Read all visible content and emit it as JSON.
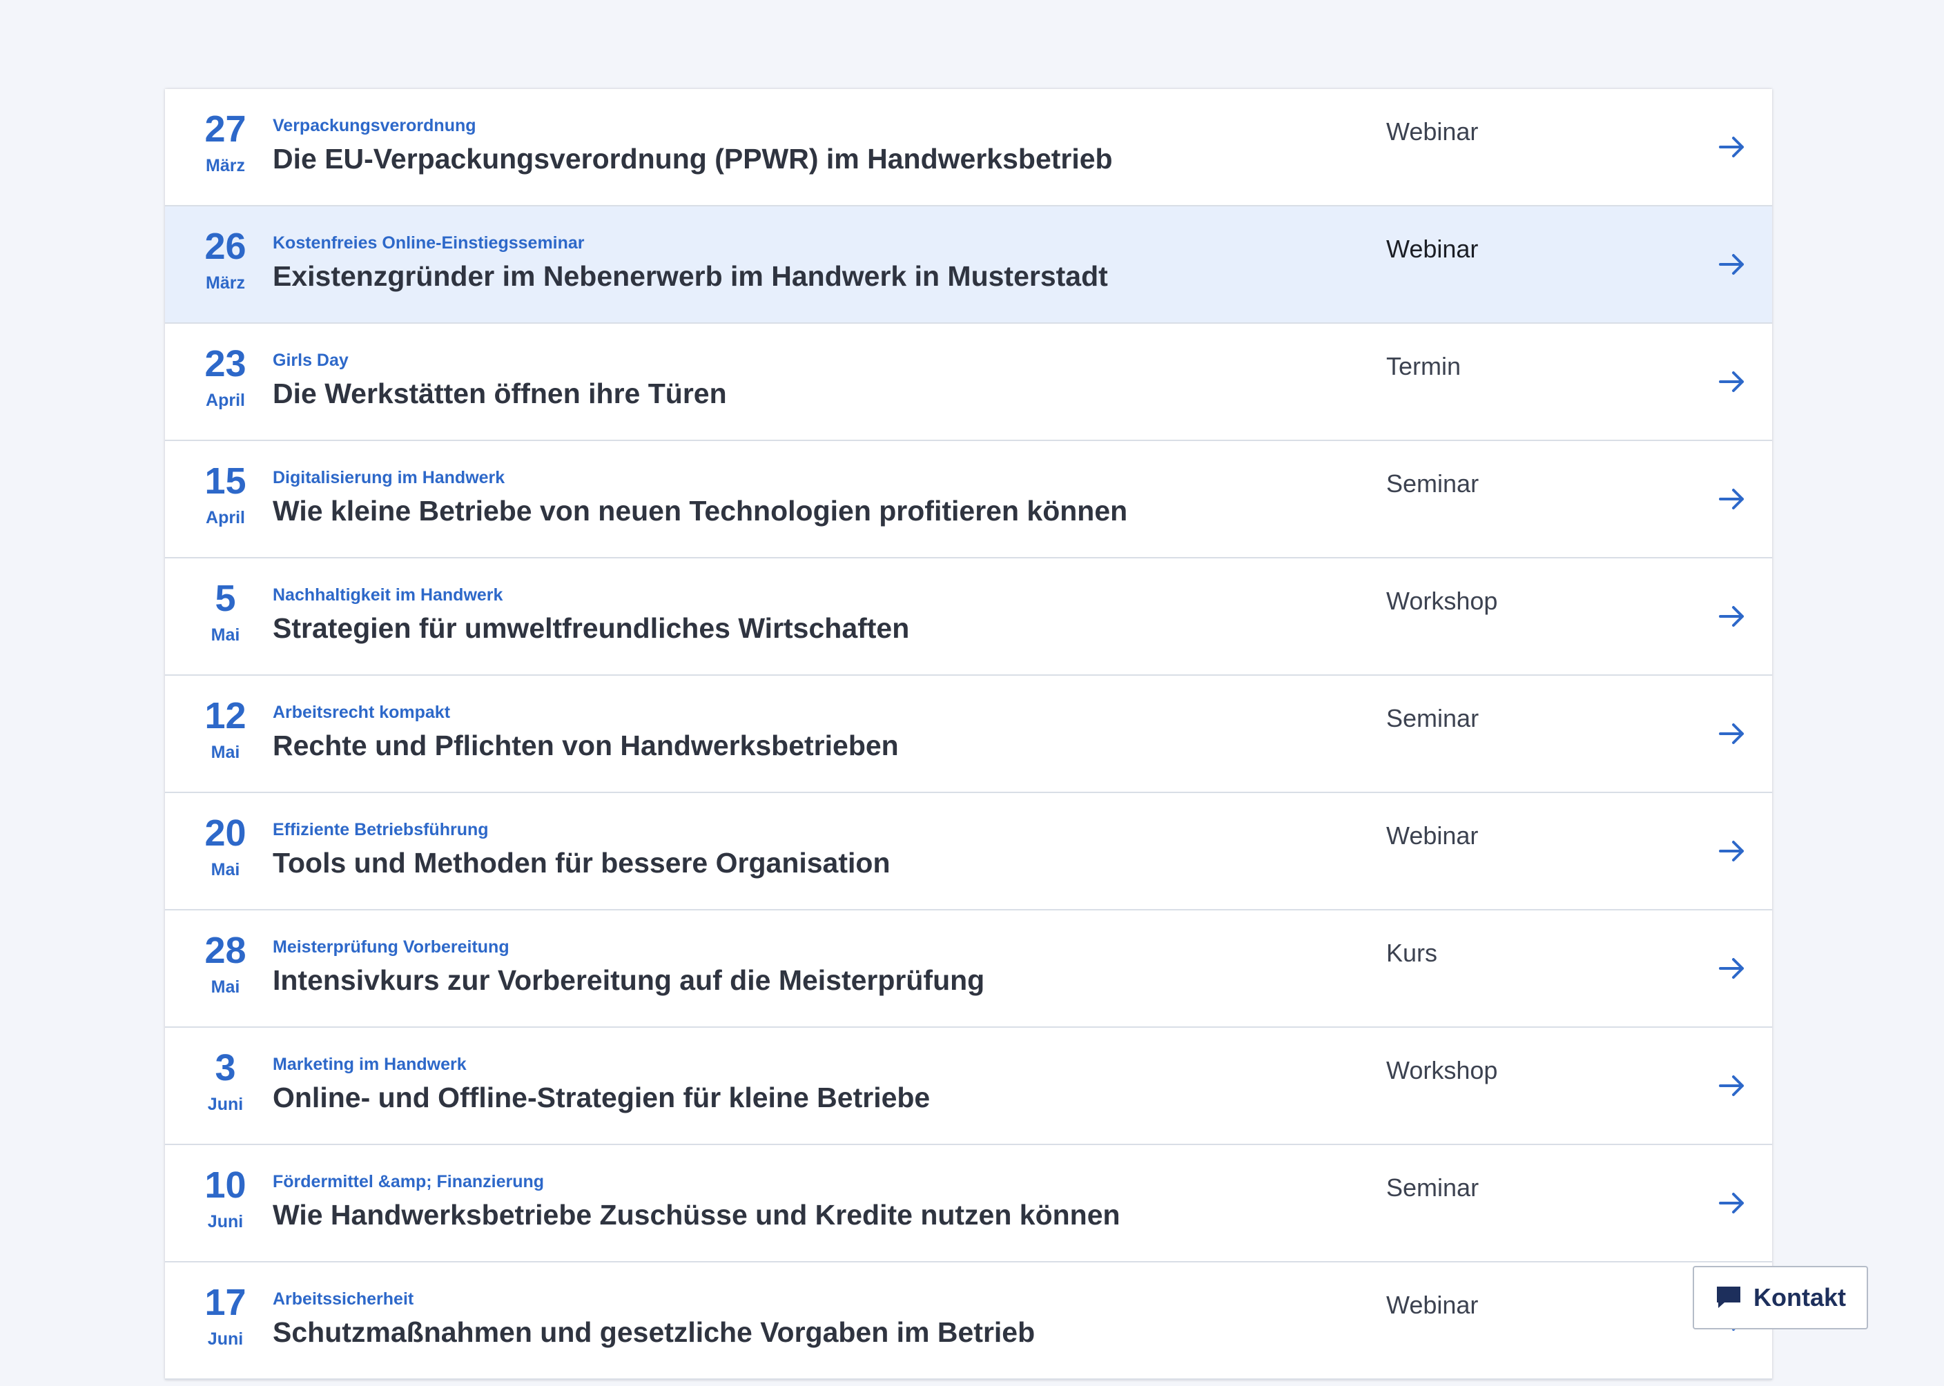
{
  "events": [
    {
      "day": "27",
      "month": "März",
      "category": "Verpackungsverordnung",
      "title": "Die EU-Verpackungsverordnung (PPWR) im Handwerksbetrieb",
      "type": "Webinar"
    },
    {
      "day": "26",
      "month": "März",
      "category": "Kostenfreies Online-Einstiegsseminar",
      "title": "Existenzgründer im Nebenerwerb im Handwerk in Musterstadt",
      "type": "Webinar"
    },
    {
      "day": "23",
      "month": "April",
      "category": "Girls Day",
      "title": "Die Werkstätten öffnen ihre Türen",
      "type": "Termin"
    },
    {
      "day": "15",
      "month": "April",
      "category": "Digitalisierung im Handwerk",
      "title": "Wie kleine Betriebe von neuen Technologien profitieren können",
      "type": "Seminar"
    },
    {
      "day": "5",
      "month": "Mai",
      "category": "Nachhaltigkeit im Handwerk",
      "title": "Strategien für umweltfreundliches Wirtschaften",
      "type": "Workshop"
    },
    {
      "day": "12",
      "month": "Mai",
      "category": "Arbeitsrecht kompakt",
      "title": "Rechte und Pflichten von Handwerksbetrieben",
      "type": "Seminar"
    },
    {
      "day": "20",
      "month": "Mai",
      "category": "Effiziente Betriebsführung",
      "title": "Tools und Methoden für bessere Organisation",
      "type": "Webinar"
    },
    {
      "day": "28",
      "month": "Mai",
      "category": "Meisterprüfung Vorbereitung",
      "title": "Intensivkurs zur Vorbereitung auf die Meisterprüfung",
      "type": "Kurs"
    },
    {
      "day": "3",
      "month": "Juni",
      "category": "Marketing im Handwerk",
      "title": "Online- und Offline-Strategien für kleine Betriebe",
      "type": "Workshop"
    },
    {
      "day": "10",
      "month": "Juni",
      "category": "Fördermittel &amp; Finanzierung",
      "title": "Wie Handwerksbetriebe Zuschüsse und Kredite nutzen können",
      "type": "Seminar"
    },
    {
      "day": "17",
      "month": "Juni",
      "category": "Arbeitssicherheit",
      "title": "Schutzmaßnahmen und gesetzliche Vorgaben im Betrieb",
      "type": "Webinar"
    }
  ],
  "kontakt": {
    "label": "Kontakt",
    "icon": "chat-icon"
  },
  "row_icon": "arrow-right-icon",
  "colors": {
    "accent": "#2d68c9",
    "title": "#2f3440",
    "highlight_row": "#e7effc",
    "background": "#f3f5fa"
  }
}
